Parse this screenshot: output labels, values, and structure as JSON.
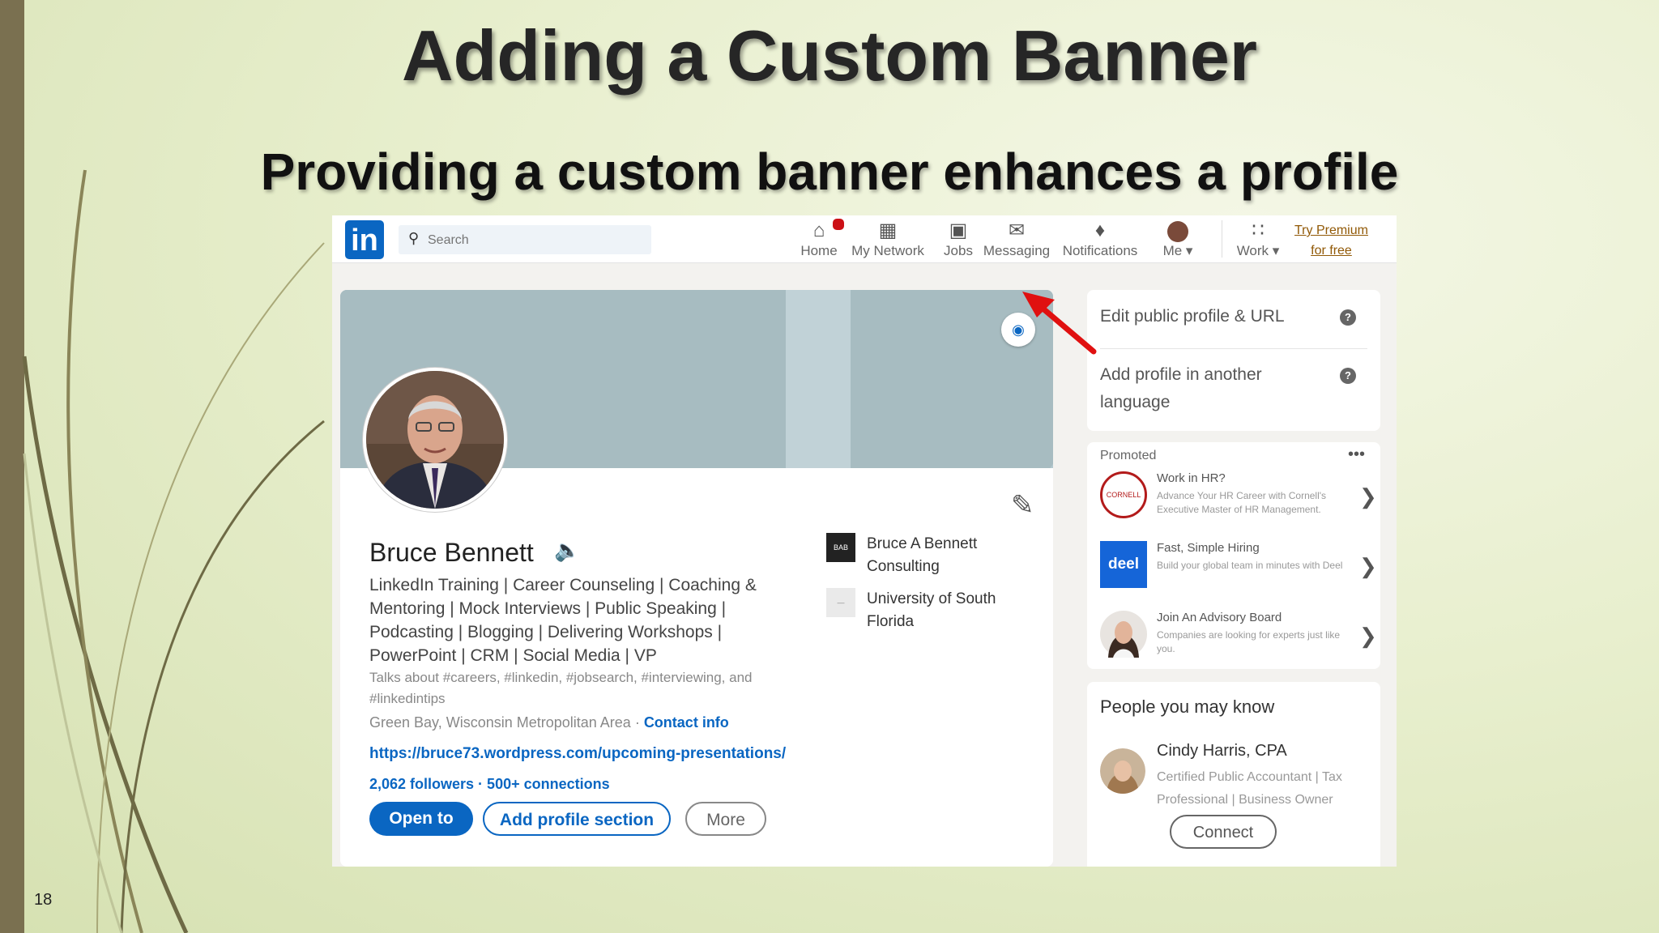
{
  "slide": {
    "title": "Adding a Custom Banner",
    "subtitle": "Providing a custom banner enhances a profile",
    "page_number": "18"
  },
  "linkedin": {
    "logo_text": "in",
    "search": {
      "placeholder": "Search",
      "icon": "search-icon"
    },
    "nav": [
      {
        "label": "Home",
        "icon": "home-icon"
      },
      {
        "label": "My Network",
        "icon": "network-icon"
      },
      {
        "label": "Jobs",
        "icon": "briefcase-icon"
      },
      {
        "label": "Messaging",
        "icon": "message-icon"
      },
      {
        "label": "Notifications",
        "icon": "bell-icon"
      },
      {
        "label": "Me ▾",
        "icon": "avatar-icon"
      },
      {
        "label": "Work ▾",
        "icon": "grid-icon"
      }
    ],
    "premium": {
      "line1": "Try Premium",
      "line2": "for free"
    },
    "profile": {
      "name": "Bruce Bennett",
      "headline": "LinkedIn Training | Career Counseling | Coaching & Mentoring | Mock Interviews | Public Speaking | Podcasting | Blogging | Delivering Workshops | PowerPoint | CRM | Social Media | VP",
      "talks_about": "Talks about #careers, #linkedin, #jobsearch, #interviewing, and #linkedintips",
      "location": "Green Bay, Wisconsin Metropolitan Area · ",
      "contact_info": "Contact info",
      "website": "https://bruce73.wordpress.com/upcoming-presentations/",
      "stats": "2,062 followers  · 500+ connections",
      "buttons": {
        "open_to": "Open to",
        "add_section": "Add profile section",
        "more": "More"
      },
      "experience": [
        {
          "logo": "BAB",
          "name": "Bruce A Bennett Consulting"
        },
        {
          "logo": "",
          "name": "University of South Florida"
        }
      ]
    },
    "sidebar": {
      "edit_profile": "Edit public profile & URL",
      "add_language": "Add profile in another language",
      "help_icon": "?",
      "promoted": {
        "label": "Promoted",
        "menu": "•••",
        "items": [
          {
            "title": "Work in HR?",
            "desc": "Advance Your HR Career with Cornell's Executive Master of HR Management.",
            "logo": "CORNELL"
          },
          {
            "title": "Fast, Simple Hiring",
            "desc": "Build your global team in minutes with Deel",
            "logo": "deel"
          },
          {
            "title": "Join An Advisory Board",
            "desc": "Companies are looking for experts just like you.",
            "logo": ""
          }
        ]
      },
      "pymk": {
        "title": "People you may know",
        "name": "Cindy Harris, CPA",
        "role": "Certified Public Accountant | Tax Professional | Business Owner",
        "connect": "Connect"
      }
    }
  },
  "colors": {
    "linkedin_blue": "#0a66c2",
    "arrow_red": "#e01010",
    "slide_bg": "#e8efce"
  }
}
